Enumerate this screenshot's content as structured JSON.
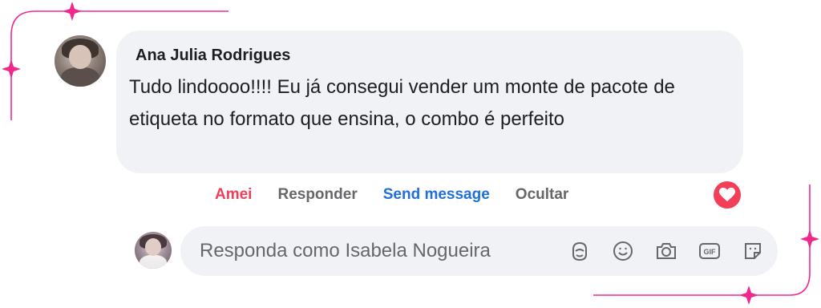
{
  "comment": {
    "author": "Ana Julia Rodrigues",
    "text": "Tudo lindoooo!!!! Eu já consegui vender um monte de pacote de etiqueta no formato que ensina, o combo é perfeito"
  },
  "actions": {
    "love": "Amei",
    "reply": "Responder",
    "send_message": "Send message",
    "hide": "Ocultar"
  },
  "reaction": {
    "icon": "heart-icon",
    "color": "#f33e58"
  },
  "reply_box": {
    "placeholder": "Responda como Isabela Nogueira",
    "icons": [
      "avatar-sticker-icon",
      "emoji-icon",
      "camera-icon",
      "gif-icon",
      "sticker-icon"
    ]
  },
  "colors": {
    "accent_pink": "#f0288c",
    "love_red": "#f33e58",
    "link_blue": "#216fdb",
    "muted_gray": "#65676b",
    "bubble_bg": "#f0f2f5"
  }
}
